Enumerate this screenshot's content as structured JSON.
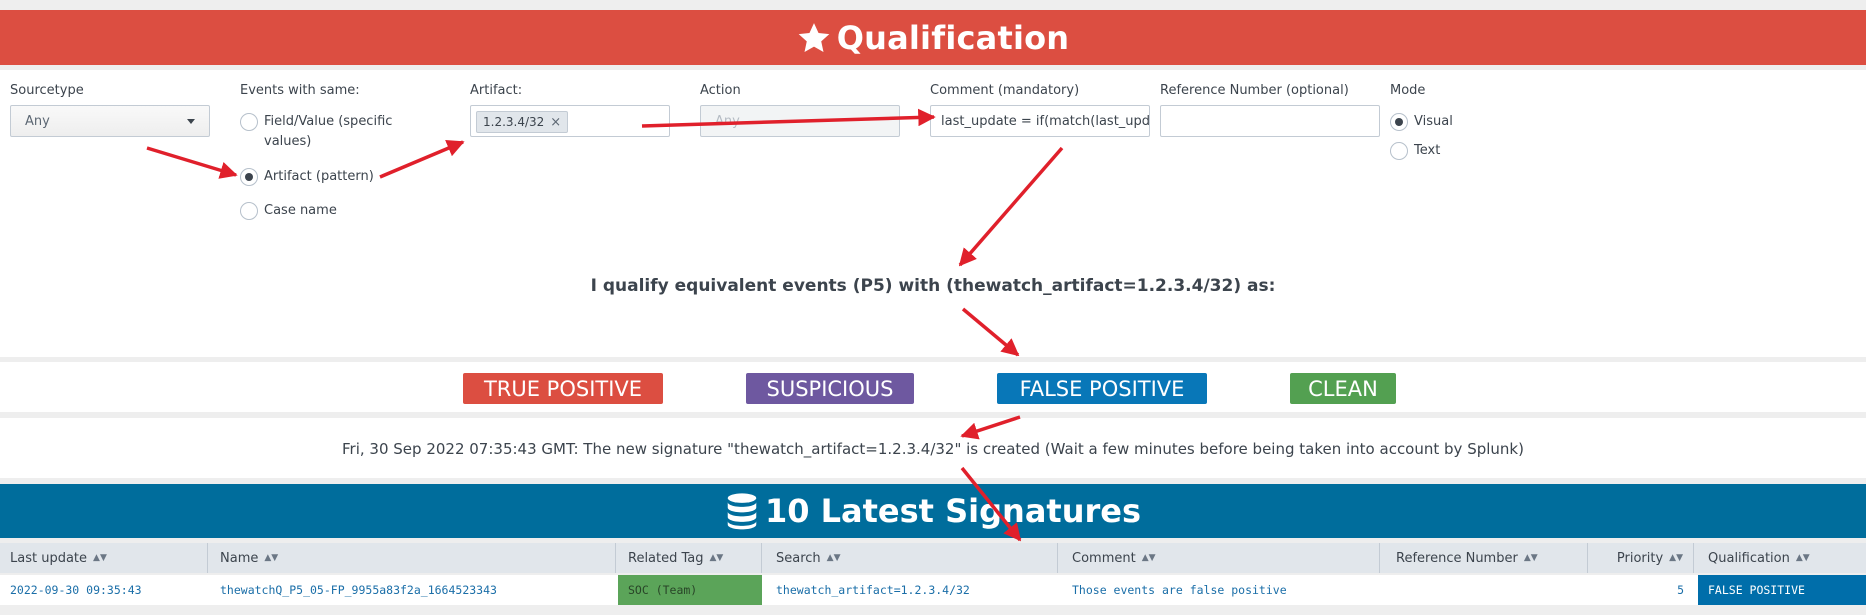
{
  "qualification_header": {
    "title": "Qualification",
    "icon": "star-icon"
  },
  "form": {
    "sourcetype": {
      "label": "Sourcetype",
      "value": "Any"
    },
    "events_with_same": {
      "label": "Events with same:",
      "options": [
        {
          "label": "Field/Value (specific values)",
          "selected": false
        },
        {
          "label": "Artifact (pattern)",
          "selected": true
        },
        {
          "label": "Case name",
          "selected": false
        }
      ]
    },
    "artifact": {
      "label": "Artifact:",
      "token": "1.2.3.4/32"
    },
    "action": {
      "label": "Action",
      "placeholder": "Any"
    },
    "comment": {
      "label": "Comment (mandatory)",
      "value": "last_update = if(match(last_upda"
    },
    "reference_number": {
      "label": "Reference Number (optional)",
      "value": ""
    },
    "mode": {
      "label": "Mode",
      "options": [
        {
          "label": "Visual",
          "selected": true
        },
        {
          "label": "Text",
          "selected": false
        }
      ]
    }
  },
  "qualify_statement": "I qualify equivalent events (P5) with (thewatch_artifact=1.2.3.4/32) as:",
  "qualification_buttons": [
    {
      "label": "TRUE POSITIVE",
      "color": "#dc4e41"
    },
    {
      "label": "SUSPICIOUS",
      "color": "#6e58a0"
    },
    {
      "label": "FALSE POSITIVE",
      "color": "#0877b8"
    },
    {
      "label": "CLEAN",
      "color": "#53a051"
    }
  ],
  "status_message": "Fri, 30 Sep 2022 07:35:43 GMT: The new signature \"thewatch_artifact=1.2.3.4/32\" is created (Wait a few minutes before being taken into account by Splunk)",
  "signatures_header": {
    "title": "10 Latest Signatures",
    "icon": "database-icon"
  },
  "signatures_table": {
    "columns": [
      "Last update",
      "Name",
      "Related Tag",
      "Search",
      "Comment",
      "Reference Number",
      "Priority",
      "Qualification"
    ],
    "rows": [
      {
        "last_update": "2022-09-30 09:35:43",
        "name": "thewatchQ_P5_05-FP_9955a83f2a_1664523343",
        "related_tag": "SOC (Team)",
        "search": "thewatch_artifact=1.2.3.4/32",
        "comment": "Those events are false positive",
        "reference_number": "",
        "priority": "5",
        "qualification": "FALSE POSITIVE"
      }
    ]
  },
  "colors": {
    "qualification_header": "#dc4e41",
    "signatures_header": "#006d9c",
    "annotation_arrows": "#e0202b",
    "tag_cell": "#53a051",
    "qualification_cell": "#006eaa"
  }
}
